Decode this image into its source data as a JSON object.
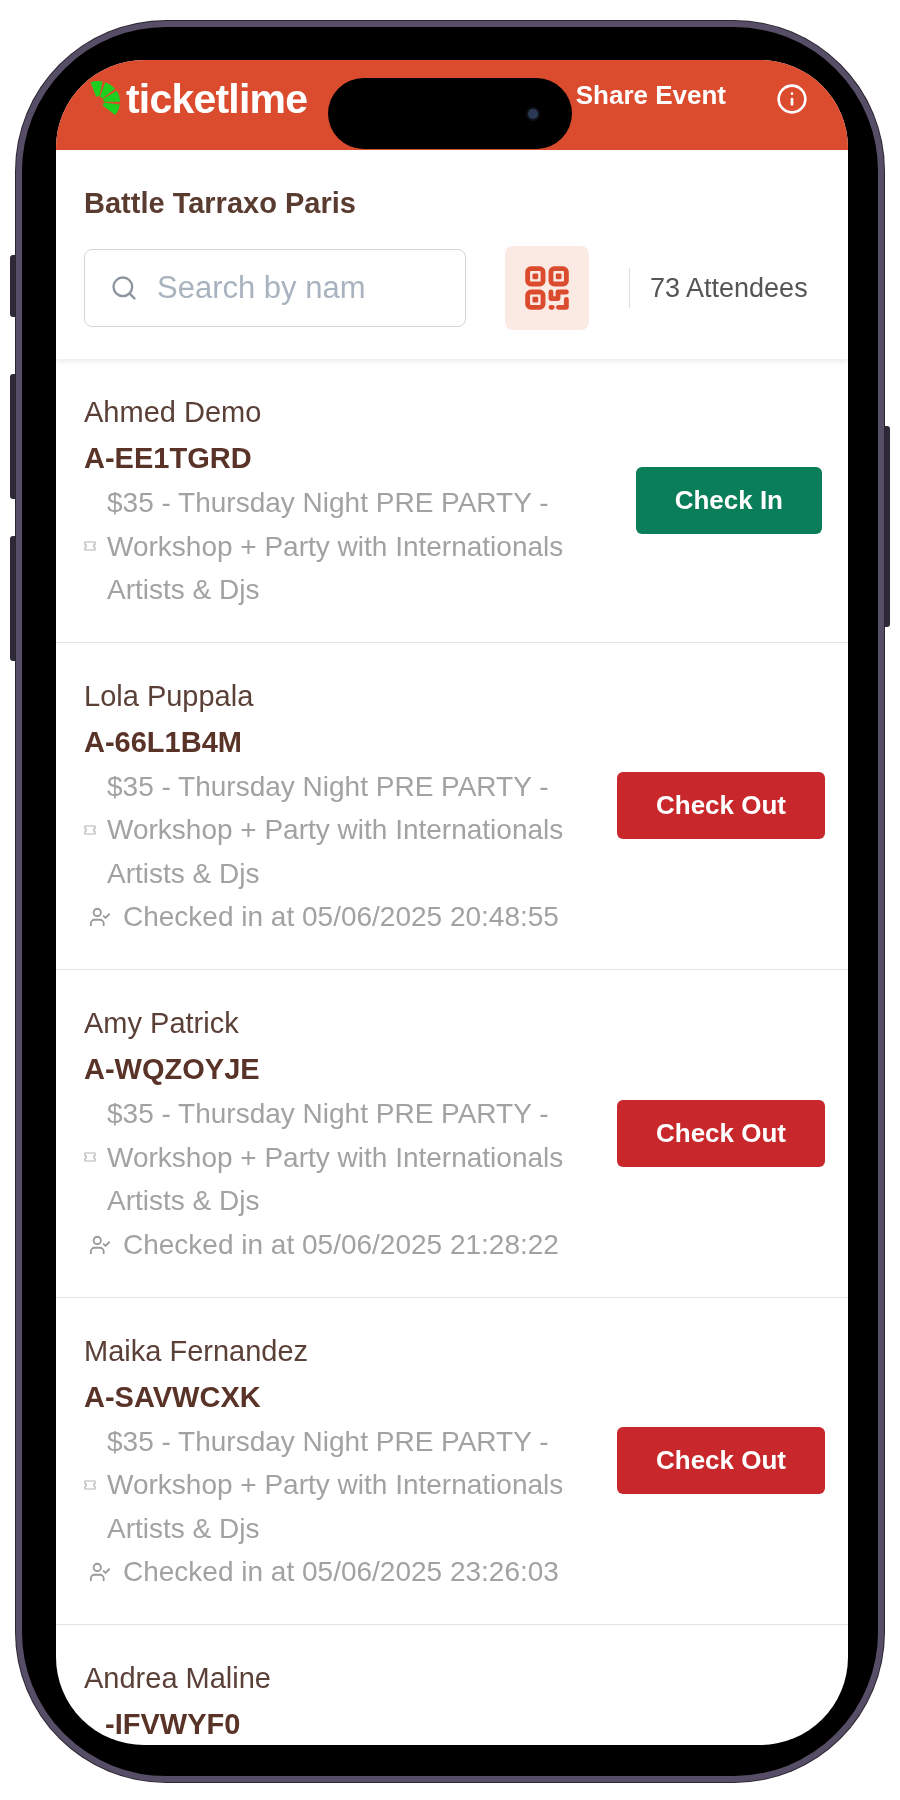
{
  "header": {
    "logo": "ticketlime",
    "share_button": "Share Event"
  },
  "event": {
    "title": "Battle Tarraxo Paris",
    "search": {
      "placeholder": "Search by nam"
    },
    "attendee_count": "73 Attendees"
  },
  "attendees": [
    {
      "name": "Ahmed Demo",
      "code": "A-EE1TGRD",
      "ticket": "$35 - Thursday Night PRE PARTY - Workshop + Party with Internationals Artists & Djs",
      "checked_in": false,
      "action": "Check In"
    },
    {
      "name": "Lola Puppala",
      "code": "A-66L1B4M",
      "ticket": "$35 - Thursday Night PRE PARTY - Workshop + Party with Internationals Artists & Djs",
      "checked_in": true,
      "checked_in_text": "Checked in at 05/06/2025 20:48:55",
      "action": "Check Out"
    },
    {
      "name": "Amy Patrick",
      "code": "A-WQZOYJE",
      "ticket": "$35 - Thursday Night PRE PARTY - Workshop + Party with Internationals Artists & Djs",
      "checked_in": true,
      "checked_in_text": "Checked in at 05/06/2025 21:28:22",
      "action": "Check Out"
    },
    {
      "name": "Maika Fernandez",
      "code": "A-SAVWCXK",
      "ticket": "$35 - Thursday Night PRE PARTY - Workshop + Party with Internationals Artists & Djs",
      "checked_in": true,
      "checked_in_text": "Checked in at 05/06/2025 23:26:03",
      "action": "Check Out"
    },
    {
      "name": "Andrea Maline",
      "code": "-IFVWYF0"
    }
  ]
}
